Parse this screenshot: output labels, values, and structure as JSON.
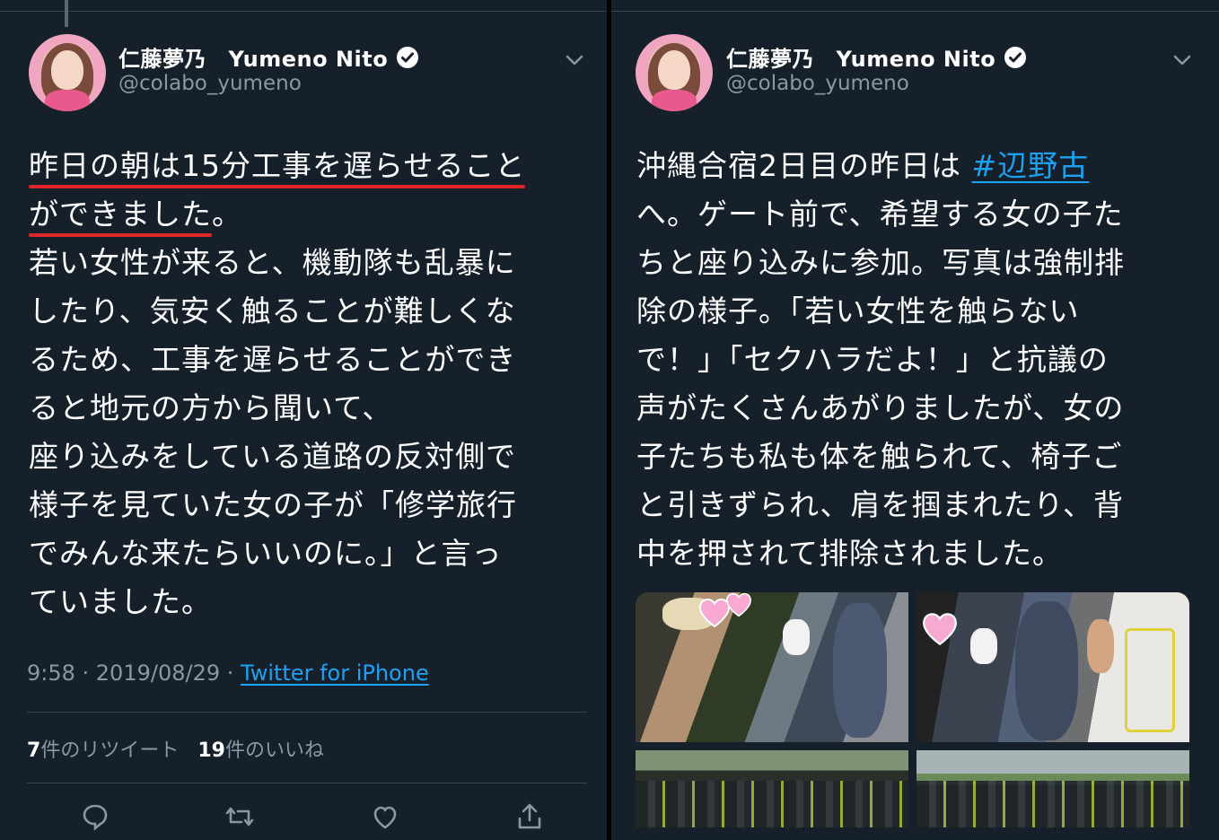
{
  "left_tweet": {
    "author": {
      "display_name": "仁藤夢乃　Yumeno Nito",
      "handle": "@colabo_yumeno",
      "verified": true
    },
    "text_lines": [
      "昨日の朝は15分工事を遅らせること",
      "ができました。",
      "若い女性が来ると、機動隊も乱暴に",
      "したり、気安く触ることが難しくな",
      "るため、工事を遅らせることができ",
      "ると地元の方から聞いて、",
      "座り込みをしている道路の反対側で",
      "様子を見ていた女の子が「修学旅行",
      "でみんな来たらいいのに。」と言っ",
      "ていました。"
    ],
    "underlined_line_1": "昨日の朝は15分工事を遅らせること",
    "underlined_line_2": "ができました",
    "line_2_tail": "。",
    "timestamp": "9:58 · 2019/08/29 · ",
    "source": "Twitter for iPhone",
    "retweet_count": "7",
    "retweet_label": "件のリツイート",
    "like_count": "19",
    "like_label": "件のいいね",
    "actions": [
      "reply-icon",
      "retweet-icon",
      "like-icon",
      "share-icon"
    ]
  },
  "right_tweet": {
    "author": {
      "display_name": "仁藤夢乃　Yumeno Nito",
      "handle": "@colabo_yumeno",
      "verified": true
    },
    "first_line_prefix": "沖縄合宿2日目の昨日は ",
    "hashtag": "#辺野古",
    "text_lines": [
      "へ。ゲート前で、希望する女の子た",
      "ちと座り込みに参加。写真は強制排",
      "除の様子。「若い女性を触らない",
      "で！」「セクハラだよ！」と抗議の",
      "声がたくさんあがりましたが、女の",
      "子たちも私も体を触られて、椅子ご",
      "と引きずられ、肩を掴まれたり、背",
      "中を押されて排除されました。"
    ],
    "photo_count": 4
  },
  "colors": {
    "background": "#15202b",
    "text": "#ffffff",
    "muted": "#8899a6",
    "link": "#1da1f2",
    "underline_annotation": "#e0252b",
    "divider": "#38444d"
  }
}
